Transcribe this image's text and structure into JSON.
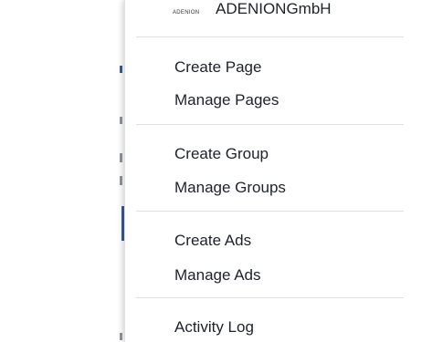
{
  "account": {
    "logo_text": "ADENION",
    "name": "ADENIONGmbH"
  },
  "pages": {
    "create_label": "Create Page",
    "manage_label": "Manage Pages"
  },
  "groups": {
    "create_label": "Create Group",
    "manage_label": "Manage Groups"
  },
  "ads": {
    "create_label": "Create Ads",
    "manage_label": "Manage Ads"
  },
  "activity": {
    "log_label": "Activity Log"
  },
  "colors": {
    "menu_text": "#1d2129",
    "divider": "#dddfe2",
    "backdrop_accent": "#3b5998"
  }
}
